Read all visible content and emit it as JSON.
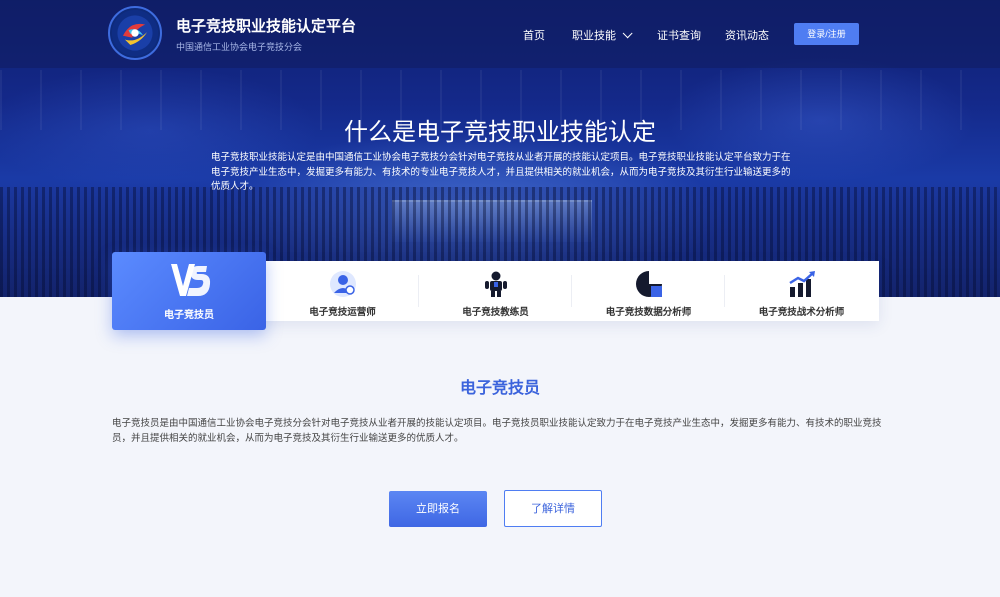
{
  "header": {
    "title": "电子竞技职业技能认定平台",
    "subtitle": "中国通信工业协会电子竞技分会",
    "nav": {
      "home": "首页",
      "skills": "职业技能",
      "cert": "证书查询",
      "news": "资讯动态"
    },
    "login": "登录/注册"
  },
  "hero": {
    "title": "什么是电子竞技职业技能认定",
    "description": "电子竞技职业技能认定是由中国通信工业协会电子竞技分会针对电子竞技从业者开展的技能认定项目。电子竞技职业技能认定平台致力于在电子竞技产业生态中，发掘更多有能力、有技术的专业电子竞技人才，并且提供相关的就业机会，从而为电子竞技及其衍生行业输送更多的优质人才。"
  },
  "tabs": [
    {
      "label": "电子竞技员",
      "icon": "vs-logo-icon",
      "active": true
    },
    {
      "label": "电子竞技运营师",
      "icon": "operator-icon",
      "active": false
    },
    {
      "label": "电子竞技教练员",
      "icon": "coach-icon",
      "active": false
    },
    {
      "label": "电子竞技数据分析师",
      "icon": "pie-chart-icon",
      "active": false
    },
    {
      "label": "电子竞技战术分析师",
      "icon": "bar-chart-trend-icon",
      "active": false
    }
  ],
  "section": {
    "title": "电子竞技员",
    "description": "电子竞技员是由中国通信工业协会电子竞技分会针对电子竞技从业者开展的技能认定项目。电子竞技员职业技能认定致力于在电子竞技产业生态中，发掘更多有能力、有技术的职业竞技员，并且提供相关的就业机会，从而为电子竞技及其衍生行业输送更多的优质人才。",
    "primary_button": "立即报名",
    "secondary_button": "了解详情"
  },
  "colors": {
    "accent": "#3b63dc",
    "button": "#4f7df2",
    "hero_bg": "#14298a"
  }
}
